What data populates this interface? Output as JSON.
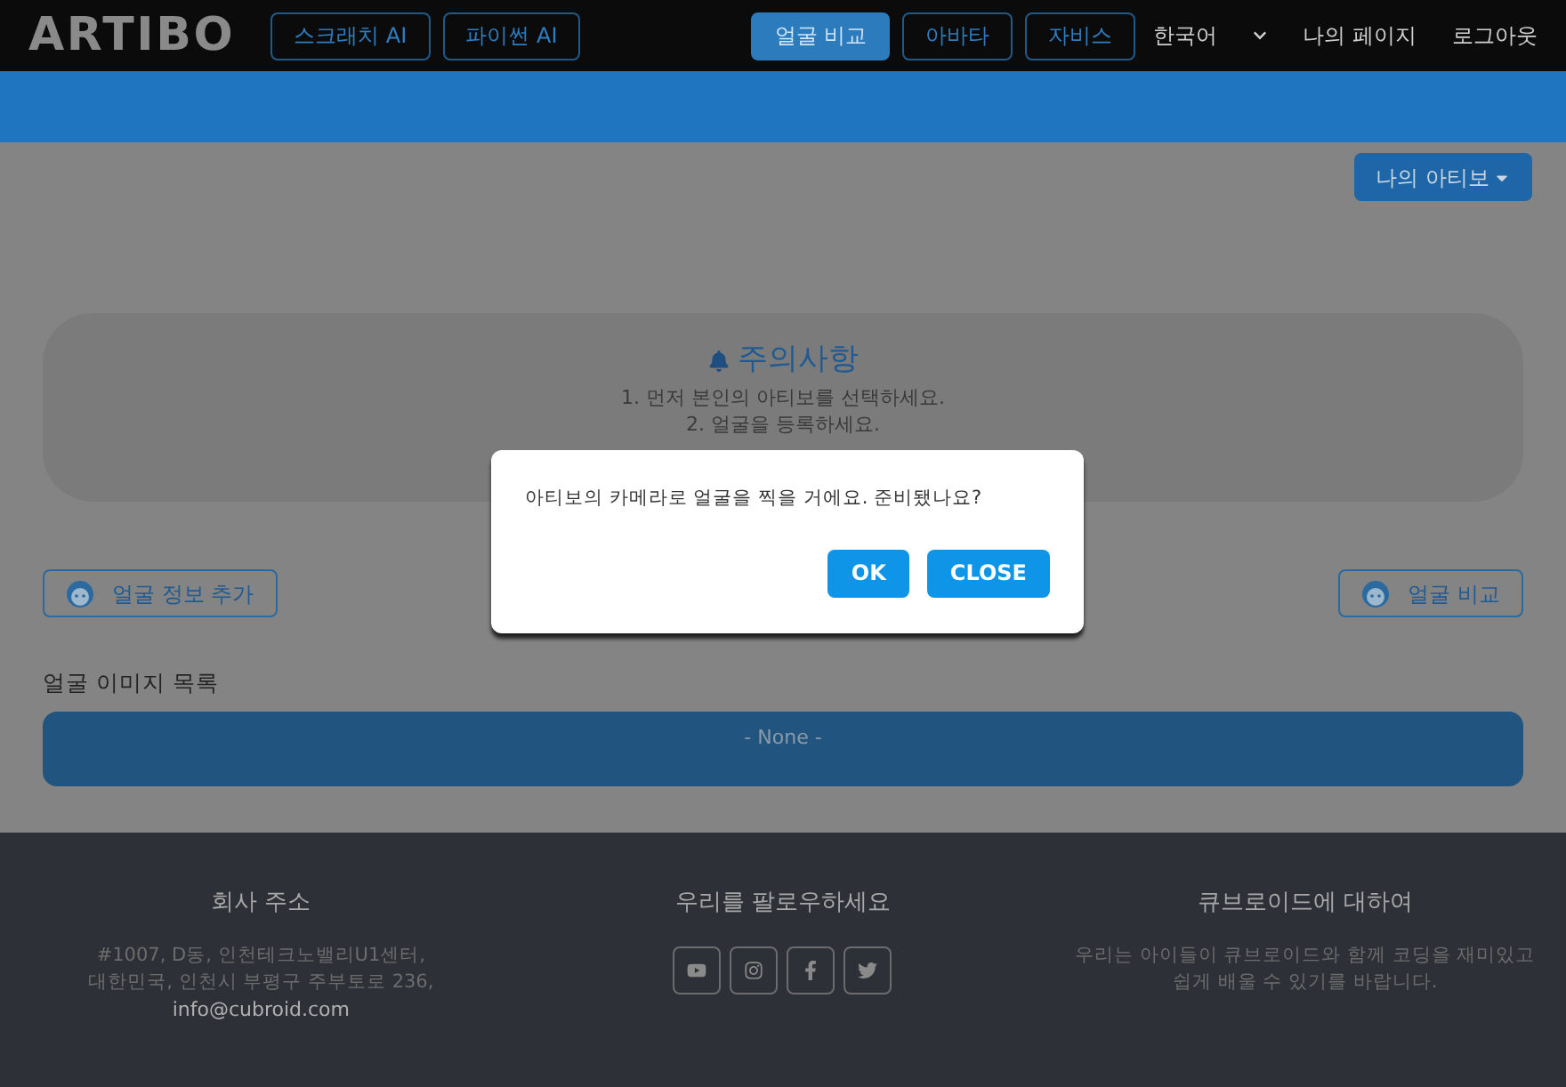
{
  "header": {
    "logo": "ARTIBO",
    "left_buttons": [
      {
        "label": "스크래치 AI",
        "selected": false
      },
      {
        "label": "파이썬 AI",
        "selected": false
      }
    ],
    "right_buttons": [
      {
        "label": "얼굴 비교",
        "selected": true
      },
      {
        "label": "아바타",
        "selected": false
      },
      {
        "label": "자비스",
        "selected": false
      }
    ],
    "language": "한국어",
    "links": [
      "나의 페이지",
      "로그아웃"
    ]
  },
  "device_dropdown": "나의 아티보",
  "notice": {
    "title": "주의사항",
    "lines": [
      "1. 먼저 본인의 아티보를 선택하세요.",
      "2. 얼굴을 등록하세요."
    ]
  },
  "actions": [
    "얼굴 정보 추가",
    "얼굴 비교"
  ],
  "image_list": {
    "label": "얼굴 이미지 목록",
    "empty": "- None -"
  },
  "dialog": {
    "message": "아티보의 카메라로 얼굴을 찍을 거에요. 준비됐나요?",
    "buttons": [
      "OK",
      "CLOSE"
    ]
  },
  "footer": {
    "address": {
      "title": "회사 주소",
      "lines": [
        "#1007, D동, 인천테크노밸리U1센터,",
        "대한민국, 인천시 부평구 주부토로 236,"
      ],
      "email": "info@cubroid.com"
    },
    "follow": {
      "title": "우리를 팔로우하세요",
      "icons": [
        {
          "kind": "youtube"
        },
        {
          "kind": "instagram"
        },
        {
          "kind": "facebook"
        },
        {
          "kind": "twitter"
        }
      ]
    },
    "about": {
      "title": "큐브로이드에 대하여",
      "text": "우리는 아이들이 큐브로이드와 함께 코딩을 재미있고 쉽게 배울 수 있기를 바랍니다."
    }
  }
}
